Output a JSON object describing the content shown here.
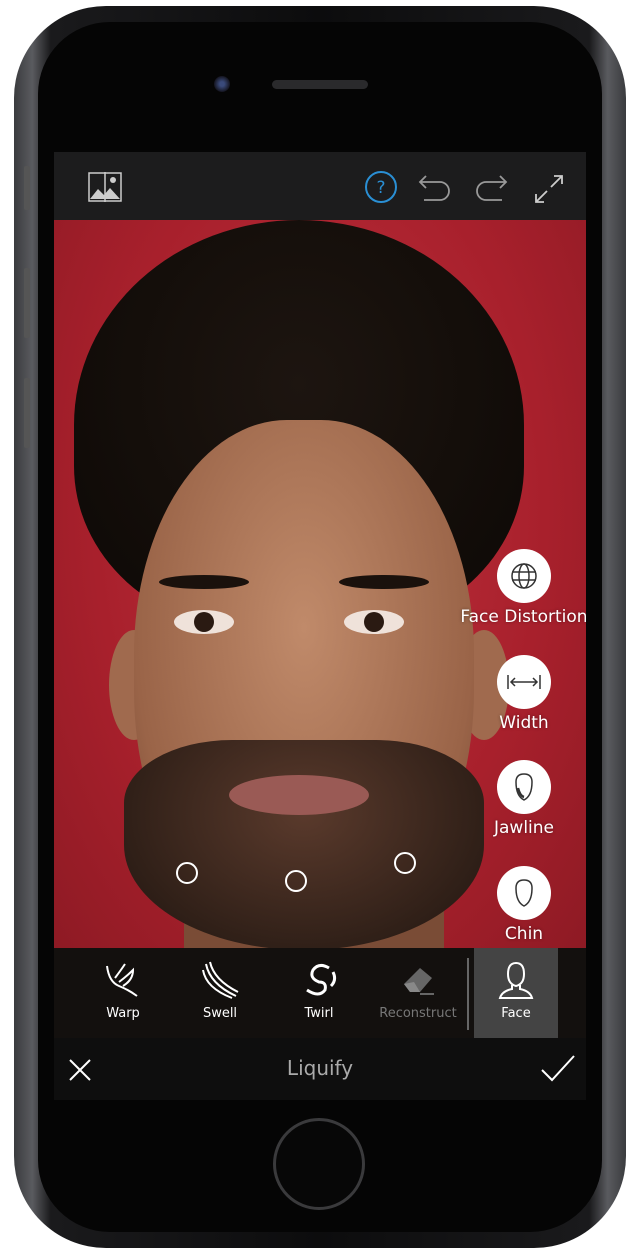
{
  "toolbar": {
    "icons": [
      "compare-icon",
      "help-icon",
      "undo-icon",
      "redo-icon",
      "fullscreen-icon"
    ],
    "accent": "#2a8fd4"
  },
  "face_options": [
    {
      "label": "Face Distortion",
      "icon": "globe-grid-icon"
    },
    {
      "label": "Width",
      "icon": "width-arrows-icon"
    },
    {
      "label": "Jawline",
      "icon": "jawline-icon"
    },
    {
      "label": "Chin",
      "icon": "chin-icon"
    }
  ],
  "tools": [
    {
      "label": "Warp",
      "icon": "warp-icon",
      "state": "normal"
    },
    {
      "label": "Swell",
      "icon": "swell-icon",
      "state": "normal"
    },
    {
      "label": "Twirl",
      "icon": "twirl-icon",
      "state": "normal"
    },
    {
      "label": "Reconstruct",
      "icon": "eraser-icon",
      "state": "disabled"
    },
    {
      "label": "Face",
      "icon": "face-icon",
      "state": "active"
    }
  ],
  "bottom": {
    "title": "Liquify",
    "cancel_icon": "close-icon",
    "confirm_icon": "check-icon"
  }
}
